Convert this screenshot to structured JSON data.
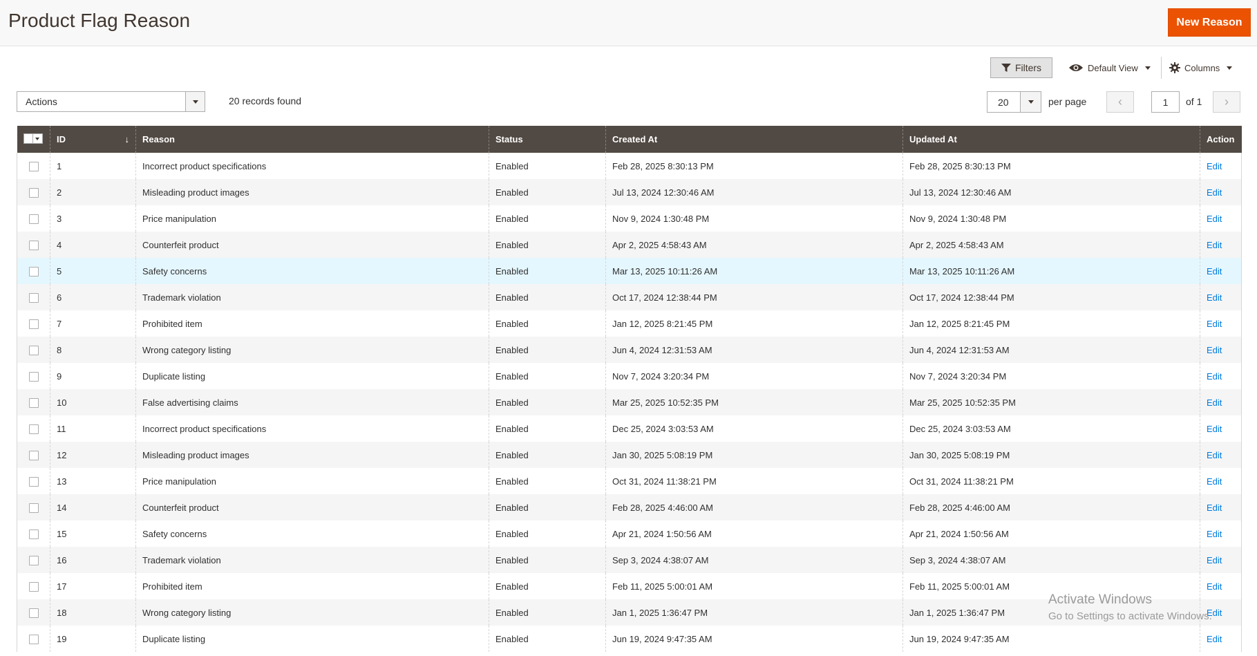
{
  "header": {
    "title": "Product Flag Reason",
    "new_button": "New Reason"
  },
  "toolbar": {
    "filters": "Filters",
    "default_view": "Default View",
    "columns": "Columns",
    "actions_label": "Actions",
    "records_found": "20 records found",
    "per_page_value": "20",
    "per_page_label": "per page",
    "current_page": "1",
    "of_pages": "of 1"
  },
  "table": {
    "headers": {
      "id": "ID",
      "reason": "Reason",
      "status": "Status",
      "created": "Created At",
      "updated": "Updated At",
      "action": "Action"
    },
    "rows": [
      {
        "id": "1",
        "reason": "Incorrect product specifications",
        "status": "Enabled",
        "created": "Feb 28, 2025 8:30:13 PM",
        "updated": "Feb 28, 2025 8:30:13 PM",
        "action": "Edit"
      },
      {
        "id": "2",
        "reason": "Misleading product images",
        "status": "Enabled",
        "created": "Jul 13, 2024 12:30:46 AM",
        "updated": "Jul 13, 2024 12:30:46 AM",
        "action": "Edit"
      },
      {
        "id": "3",
        "reason": "Price manipulation",
        "status": "Enabled",
        "created": "Nov 9, 2024 1:30:48 PM",
        "updated": "Nov 9, 2024 1:30:48 PM",
        "action": "Edit"
      },
      {
        "id": "4",
        "reason": "Counterfeit product",
        "status": "Enabled",
        "created": "Apr 2, 2025 4:58:43 AM",
        "updated": "Apr 2, 2025 4:58:43 AM",
        "action": "Edit"
      },
      {
        "id": "5",
        "reason": "Safety concerns",
        "status": "Enabled",
        "created": "Mar 13, 2025 10:11:26 AM",
        "updated": "Mar 13, 2025 10:11:26 AM",
        "action": "Edit"
      },
      {
        "id": "6",
        "reason": "Trademark violation",
        "status": "Enabled",
        "created": "Oct 17, 2024 12:38:44 PM",
        "updated": "Oct 17, 2024 12:38:44 PM",
        "action": "Edit"
      },
      {
        "id": "7",
        "reason": "Prohibited item",
        "status": "Enabled",
        "created": "Jan 12, 2025 8:21:45 PM",
        "updated": "Jan 12, 2025 8:21:45 PM",
        "action": "Edit"
      },
      {
        "id": "8",
        "reason": "Wrong category listing",
        "status": "Enabled",
        "created": "Jun 4, 2024 12:31:53 AM",
        "updated": "Jun 4, 2024 12:31:53 AM",
        "action": "Edit"
      },
      {
        "id": "9",
        "reason": "Duplicate listing",
        "status": "Enabled",
        "created": "Nov 7, 2024 3:20:34 PM",
        "updated": "Nov 7, 2024 3:20:34 PM",
        "action": "Edit"
      },
      {
        "id": "10",
        "reason": "False advertising claims",
        "status": "Enabled",
        "created": "Mar 25, 2025 10:52:35 PM",
        "updated": "Mar 25, 2025 10:52:35 PM",
        "action": "Edit"
      },
      {
        "id": "11",
        "reason": "Incorrect product specifications",
        "status": "Enabled",
        "created": "Dec 25, 2024 3:03:53 AM",
        "updated": "Dec 25, 2024 3:03:53 AM",
        "action": "Edit"
      },
      {
        "id": "12",
        "reason": "Misleading product images",
        "status": "Enabled",
        "created": "Jan 30, 2025 5:08:19 PM",
        "updated": "Jan 30, 2025 5:08:19 PM",
        "action": "Edit"
      },
      {
        "id": "13",
        "reason": "Price manipulation",
        "status": "Enabled",
        "created": "Oct 31, 2024 11:38:21 PM",
        "updated": "Oct 31, 2024 11:38:21 PM",
        "action": "Edit"
      },
      {
        "id": "14",
        "reason": "Counterfeit product",
        "status": "Enabled",
        "created": "Feb 28, 2025 4:46:00 AM",
        "updated": "Feb 28, 2025 4:46:00 AM",
        "action": "Edit"
      },
      {
        "id": "15",
        "reason": "Safety concerns",
        "status": "Enabled",
        "created": "Apr 21, 2024 1:50:56 AM",
        "updated": "Apr 21, 2024 1:50:56 AM",
        "action": "Edit"
      },
      {
        "id": "16",
        "reason": "Trademark violation",
        "status": "Enabled",
        "created": "Sep 3, 2024 4:38:07 AM",
        "updated": "Sep 3, 2024 4:38:07 AM",
        "action": "Edit"
      },
      {
        "id": "17",
        "reason": "Prohibited item",
        "status": "Enabled",
        "created": "Feb 11, 2025 5:00:01 AM",
        "updated": "Feb 11, 2025 5:00:01 AM",
        "action": "Edit"
      },
      {
        "id": "18",
        "reason": "Wrong category listing",
        "status": "Enabled",
        "created": "Jan 1, 2025 1:36:47 PM",
        "updated": "Jan 1, 2025 1:36:47 PM",
        "action": "Edit"
      },
      {
        "id": "19",
        "reason": "Duplicate listing",
        "status": "Enabled",
        "created": "Jun 19, 2024 9:47:35 AM",
        "updated": "Jun 19, 2024 9:47:35 AM",
        "action": "Edit"
      }
    ]
  },
  "watermark": {
    "line1": "Activate Windows",
    "line2": "Go to Settings to activate Windows."
  },
  "colors": {
    "accent": "#eb5202",
    "header_bg": "#514943",
    "link": "#007bdb"
  },
  "icons": {
    "filter": "filter-icon",
    "view": "eye-icon",
    "columns": "gear-icon"
  }
}
